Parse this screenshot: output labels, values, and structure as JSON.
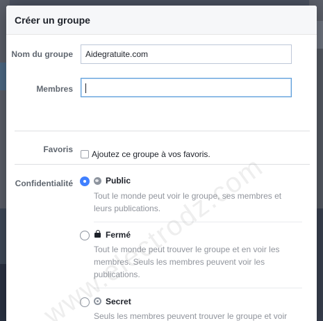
{
  "dialog": {
    "title": "Créer un groupe"
  },
  "form": {
    "name_label": "Nom du groupe",
    "name_value": "Aidegratuite.com",
    "members_label": "Membres",
    "members_value": "",
    "favorites_label": "Favoris",
    "favorites_checkbox_text": "Ajoutez ce groupe à vos favoris.",
    "favorites_checked": false,
    "privacy_label": "Confidentialité",
    "privacy_options": [
      {
        "title": "Public",
        "icon": "globe-icon",
        "selected": true,
        "description": "Tout le monde peut voir le groupe, ses membres et leurs publications."
      },
      {
        "title": "Fermé",
        "icon": "lock-icon",
        "selected": false,
        "description": "Tout le monde peut trouver le groupe et en voir les membres. Seuls les membres peuvent voir les publications."
      },
      {
        "title": "Secret",
        "icon": "secret-icon",
        "selected": false,
        "description": "Seuls les membres peuvent trouver le groupe et voir"
      }
    ]
  },
  "watermark": "www.electrodz.com",
  "colors": {
    "accent": "#4080ff",
    "label": "#606770",
    "muted_text": "#90949c"
  }
}
